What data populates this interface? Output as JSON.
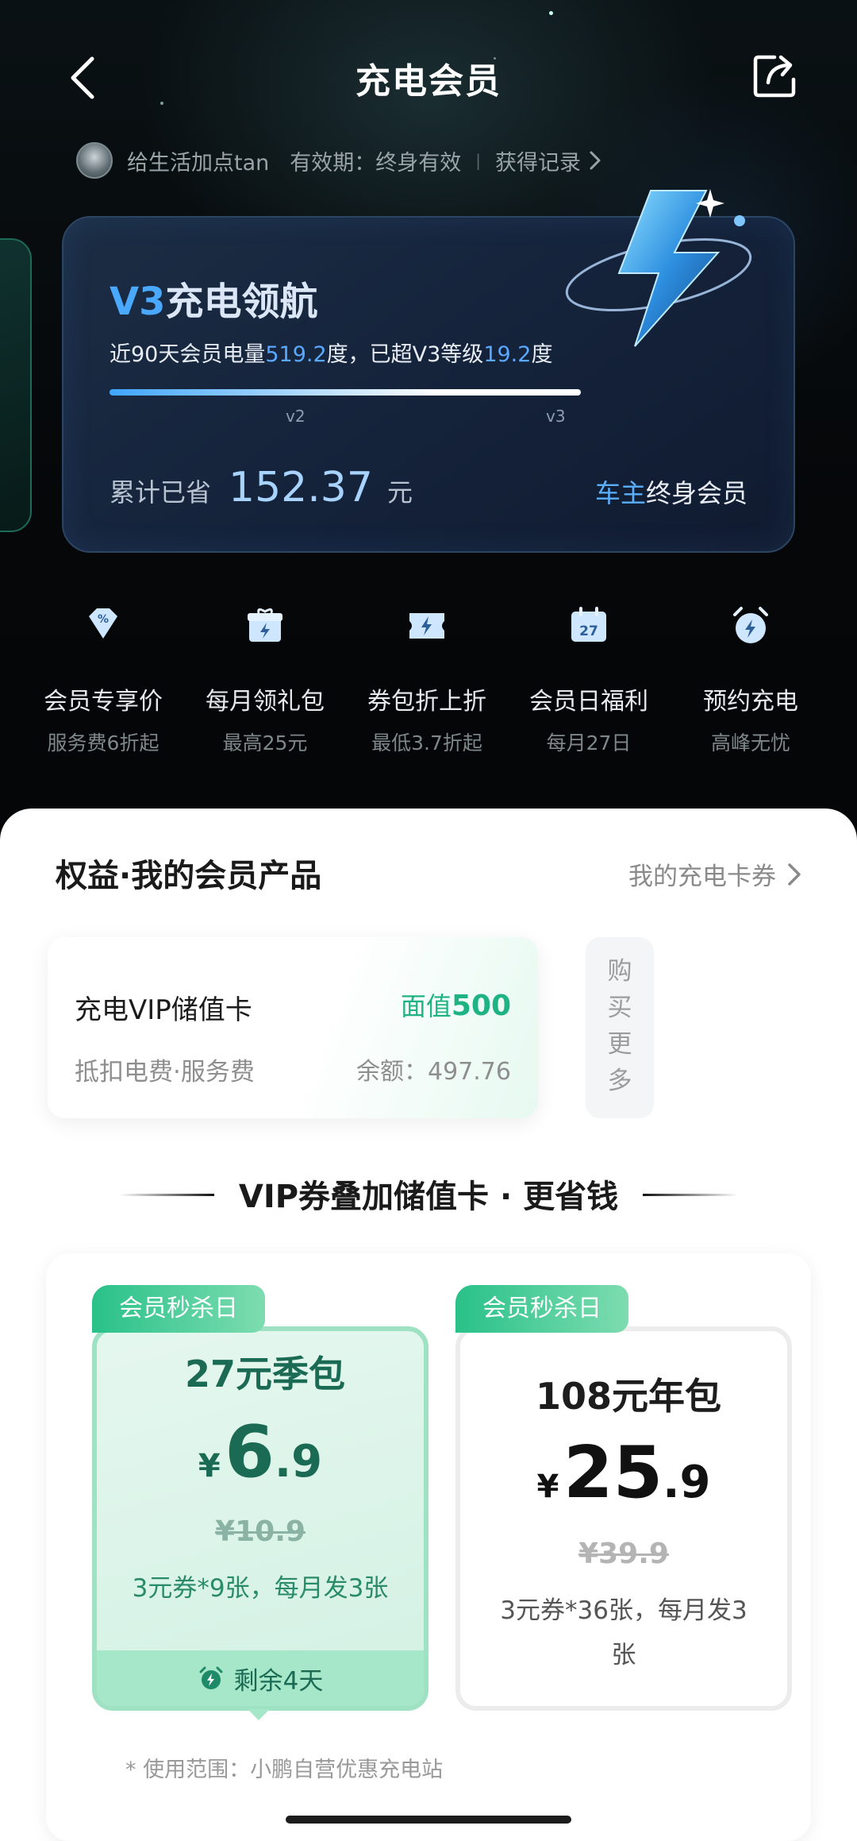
{
  "header": {
    "title": "充电会员"
  },
  "user": {
    "name": "给生活加点tan",
    "validity": "有效期：终身有效",
    "record_link": "获得记录"
  },
  "level_card": {
    "level": "V3",
    "title_rest": "充电领航",
    "desc_prefix": "近90天会员电量",
    "power": "519.2",
    "desc_mid": "度，已超V3等级",
    "exceed": "19.2",
    "desc_suffix": "度",
    "progress": 1.0,
    "tick_v2": "v2",
    "tick_v3": "v3",
    "saved_label": "累计已省",
    "saved_amount": "152.37",
    "saved_unit": "元",
    "member_type_hl": "车主",
    "member_type_rest": "终身会员"
  },
  "benefits": [
    {
      "icon": "percent-diamond-icon",
      "name": "会员专享价",
      "sub": "服务费6折起"
    },
    {
      "icon": "gift-icon",
      "name": "每月领礼包",
      "sub": "最高25元"
    },
    {
      "icon": "coupon-icon",
      "name": "券包折上折",
      "sub": "最低3.7折起"
    },
    {
      "icon": "calendar-icon",
      "name": "会员日福利",
      "sub": "每月27日",
      "day": "27"
    },
    {
      "icon": "alarm-icon",
      "name": "预约充电",
      "sub": "高峰无忧"
    }
  ],
  "products": {
    "section_title": "权益·我的会员产品",
    "my_cards_link": "我的充电卡券",
    "vip_card": {
      "name": "充电VIP储值卡",
      "face_value_label": "面值",
      "face_value": "500",
      "desc": "抵扣电费·服务费",
      "balance": "余额：497.76"
    },
    "buy_more": [
      "购",
      "买",
      "更",
      "多"
    ]
  },
  "promo": {
    "heading": "VIP券叠加储值卡 · 更省钱",
    "packs": [
      {
        "badge": "会员秒杀日",
        "name": "27元季包",
        "yen": "¥",
        "price_int": "6",
        "price_dec": ".9",
        "original": "¥10.9",
        "desc": "3元券*9张，每月发3张",
        "remain": "剩余4天"
      },
      {
        "badge": "会员秒杀日",
        "name": "108元年包",
        "yen": "¥",
        "price_int": "25",
        "price_dec": ".9",
        "original": "¥39.9",
        "desc": "3元券*36张，每月发3张"
      }
    ],
    "scope_note": "* 使用范围：小鹏自营优惠充电站"
  },
  "colors": {
    "accent_green": "#1fb383",
    "accent_blue": "#4aa9ff"
  }
}
